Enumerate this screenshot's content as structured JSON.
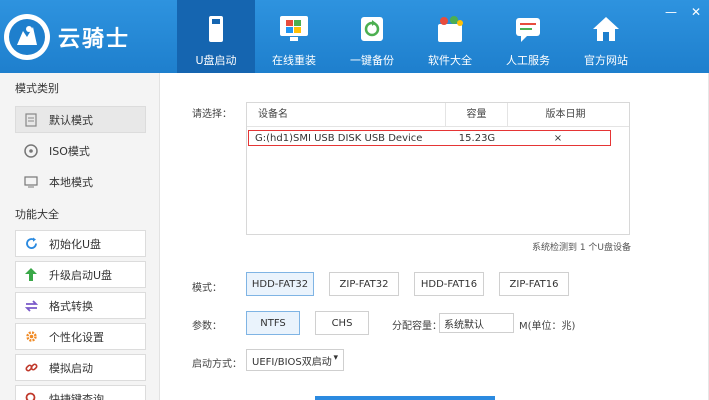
{
  "header": {
    "brand": "云骑士",
    "nav": [
      {
        "label": "U盘启动",
        "icon": "usb-drive-icon",
        "active": true
      },
      {
        "label": "在线重装",
        "icon": "windows-monitor-icon",
        "active": false
      },
      {
        "label": "一键备份",
        "icon": "backup-icon",
        "active": false
      },
      {
        "label": "软件大全",
        "icon": "software-box-icon",
        "active": false
      },
      {
        "label": "人工服务",
        "icon": "chat-service-icon",
        "active": false
      },
      {
        "label": "官方网站",
        "icon": "home-icon",
        "active": false
      }
    ],
    "window_controls": {
      "minimize": "—",
      "close": "✕"
    },
    "colors": {
      "bar": "#2089d6",
      "active": "#1565b0"
    }
  },
  "sidebar": {
    "mode_title": "模式类别",
    "modes": [
      {
        "label": "默认模式",
        "icon": "document-icon",
        "selected": true
      },
      {
        "label": "ISO模式",
        "icon": "disc-icon",
        "selected": false
      },
      {
        "label": "本地模式",
        "icon": "monitor-icon",
        "selected": false
      }
    ],
    "func_title": "功能大全",
    "functions": [
      {
        "label": "初始化U盘",
        "icon": "refresh-icon"
      },
      {
        "label": "升级启动U盘",
        "icon": "upgrade-arrow-icon"
      },
      {
        "label": "格式转换",
        "icon": "convert-arrows-icon"
      },
      {
        "label": "个性化设置",
        "icon": "settings-gear-icon"
      },
      {
        "label": "模拟启动",
        "icon": "link-icon"
      },
      {
        "label": "快捷键查询",
        "icon": "search-icon"
      }
    ]
  },
  "main": {
    "select_label": "请选择：",
    "table": {
      "headers": [
        "设备名",
        "容量",
        "版本日期"
      ],
      "rows": [
        {
          "device": "G:(hd1)SMI USB DISK USB Device",
          "size": "15.23G",
          "date": "×"
        }
      ]
    },
    "count_text": "系统检测到 1 个U盘设备",
    "mode_label": "模式：",
    "modes": [
      {
        "label": "HDD-FAT32",
        "selected": true
      },
      {
        "label": "ZIP-FAT32",
        "selected": false
      },
      {
        "label": "HDD-FAT16",
        "selected": false
      },
      {
        "label": "ZIP-FAT16",
        "selected": false
      }
    ],
    "param_label": "参数：",
    "fs": [
      {
        "label": "NTFS",
        "selected": true
      },
      {
        "label": "CHS",
        "selected": false
      }
    ],
    "alloc_label": "分配容量：",
    "alloc_value": "系统默认",
    "alloc_unit": "M(单位：兆)",
    "boot_label": "启动方式：",
    "boot_value": "UEFI/BIOS双启动"
  }
}
